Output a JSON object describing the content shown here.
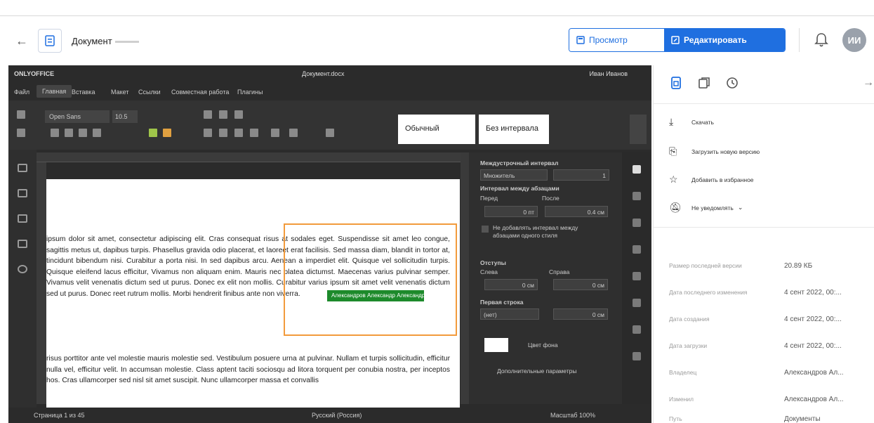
{
  "header": {
    "doc_name": "Документ",
    "view_label": "Просмотр",
    "edit_label": "Редактировать",
    "avatar_initials": "ИИ"
  },
  "editor": {
    "brand": "ONLYOFFICE",
    "doc_title": "Документ.docx",
    "user_name": "Иван Иванов",
    "menu": [
      "Файл",
      "Главная",
      "Вставка",
      "Макет",
      "Ссылки",
      "Совместная работа",
      "Плагины"
    ],
    "active_menu": "Главная",
    "font_name": "Open Sans",
    "font_size": "10.5",
    "style_normal": "Обычный",
    "style_no_spacing": "Без интервала",
    "paragraphs": [
      "ipsum dolor sit amet, consectetur adipiscing elit. Cras consequat risus at sodales eget. Suspendisse sit amet leo congue, sagittis metus ut, dapibus turpis. Phasellus gravida odio placerat, et laoreet erat facilisis. Sed massa diam, blandit in tortor at, tincidunt bibendum nisi. Curabitur a porta nisi. In sed dapibus arcu. Aenean a imperdiet elit. Quisque vel sollicitudin turpis. Quisque eleifend lacus efficitur, Vivamus non aliquam enim. Mauris nec platea dictumst. Maecenas varius pulvinar semper. Vivamus velit venenatis dictum sed ut purus. Donec ex elit non mollis. Curabitur varius ipsum sit amet velit venenatis dictum sed ut purus. Donec reet rutrum mollis. Morbi hendrerit finibus ante non viverra.",
      "risus porttitor ante vel molestie mauris molestie sed. Vestibulum posuere urna at pulvinar. Nullam et turpis sollicitudin, efficitur nulla vel, efficitur velit. In accumsan molestie. Class aptent taciti sociosqu ad litora torquent per conubia nostra, per inceptos hos. Cras ullamcorper sed nisl sit amet suscipit. Nunc ullamcorper massa et convallis"
    ],
    "collab_tag": "Александров Александр Александрович",
    "right_panel": {
      "line_spacing_label": "Междустрочный интервал",
      "line_spacing_value": "Множитель",
      "line_spacing_num": "1",
      "para_spacing_label": "Интервал между абзацами",
      "before_label": "Перед",
      "after_label": "После",
      "before_value": "0 пт",
      "after_value": "0.4 см",
      "no_interval_label": "Не добавлять интервал между абзацами одного стиля",
      "indents_label": "Отступы",
      "left_label": "Слева",
      "right_label": "Справа",
      "left_value": "0 см",
      "right_value": "0 см",
      "first_line_label": "Первая строка",
      "first_line_type": "(нет)",
      "first_line_value": "0 см",
      "bg_color_label": "Цвет фона",
      "advanced_label": "Дополнительные параметры"
    },
    "status_page": "Страница 1 из 45",
    "status_lang": "Русский (Россия)",
    "status_zoom": "Масштаб 100%"
  },
  "sidebar": {
    "actions": [
      "Скачать",
      "Загрузить новую версию",
      "Добавить в избранное",
      "Не уведомлять"
    ],
    "properties": [
      {
        "key": "Размер последней версии",
        "value": "20.89 КБ"
      },
      {
        "key": "Дата последнего изменения",
        "value": "4 сент 2022, 00:..."
      },
      {
        "key": "Дата создания",
        "value": "4 сент 2022, 00:..."
      },
      {
        "key": "Дата загрузки",
        "value": "4 сент 2022, 00:..."
      },
      {
        "key": "Владелец",
        "value": "Александров Ал..."
      },
      {
        "key": "Изменил",
        "value": "Александров Ал..."
      },
      {
        "key": "Путь",
        "value": "Документы"
      }
    ]
  }
}
